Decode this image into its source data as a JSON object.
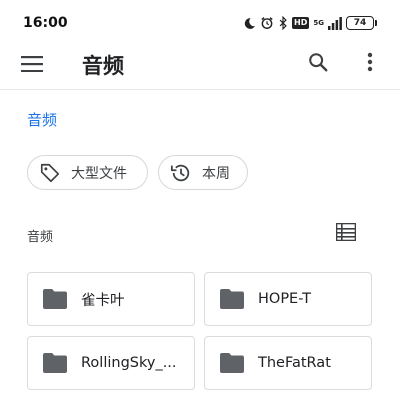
{
  "status_bar": {
    "time": "16:00",
    "hd_label": "HD",
    "network_label": "5G",
    "battery_level": "74",
    "icons": [
      "moon-icon",
      "alarm-icon",
      "bluetooth-icon",
      "hd-icon",
      "signal-icon",
      "battery-icon"
    ]
  },
  "app_bar": {
    "title": "音频",
    "icons": [
      "menu-icon",
      "search-icon",
      "more-vert-icon"
    ]
  },
  "breadcrumb": {
    "current": "音频"
  },
  "filters": [
    {
      "label": "大型文件",
      "icon": "tag-icon"
    },
    {
      "label": "本周",
      "icon": "history-icon"
    }
  ],
  "section": {
    "title": "音频",
    "view_icon": "list-view-icon"
  },
  "folders": [
    {
      "name": "雀卡叶"
    },
    {
      "name": "HOPE-T"
    },
    {
      "name": "RollingSky_..."
    },
    {
      "name": "TheFatRat"
    }
  ],
  "colors": {
    "accent": "#1a73e8",
    "folder_icon": "#5f6368",
    "divider": "#e6e6e6"
  }
}
